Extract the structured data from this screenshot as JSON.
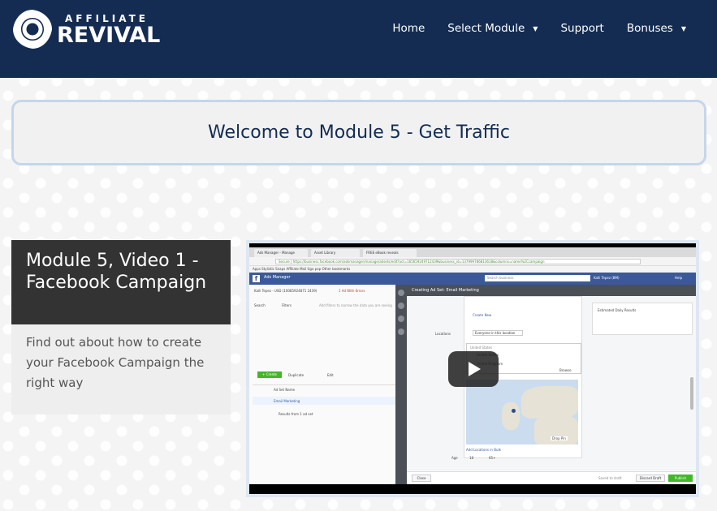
{
  "brand": {
    "line1": "AFFILIATE",
    "line2": "REVIVAL"
  },
  "nav": {
    "items": [
      {
        "label": "Home",
        "dropdown": false
      },
      {
        "label": "Select Module",
        "dropdown": true
      },
      {
        "label": "Support",
        "dropdown": false
      },
      {
        "label": "Bonuses",
        "dropdown": true
      }
    ]
  },
  "welcome": {
    "title": "Welcome to Module 5 - Get Traffic"
  },
  "card": {
    "title": "Module 5, Video 1 - Facebook Campaign",
    "description": "Find out about how to create your Facebook Campaign the right way"
  },
  "video": {
    "tabs": [
      "Ads Manager - Manage",
      "Asset Library",
      "FREE eBook reveals"
    ],
    "url": "Secure | https://business.facebook.com/adsmanager/manage/adsets/edit?act=165659249712439&business_id=137999786813618&columns=name%2Ccampaign",
    "bookmarks": "Apps  Stylistic Snaps  Affiliate  Mail  Ugo  pop  Other bookmarks",
    "app_title": "Ads Manager",
    "search_placeholder": "Search business",
    "account": "Kalli Tepez (BM)",
    "help": "Help",
    "account_select": "Kalli Tepez - USD (10085924871 2439)",
    "errors": "1 Ad With Errors",
    "search_label": "Search",
    "filters_label": "Filters",
    "filter_hint": "Add filters to narrow the data you are seeing",
    "create_label": "+ Create",
    "duplicate_label": "Duplicate",
    "edit_label": "Edit",
    "col_header": "Ad Set Name",
    "row_name": "Email Marketing",
    "row_sub": "Results from 1 ad set",
    "panel_title": "Creating Ad Set: Email Marketing",
    "create_new": "Create New",
    "locations_label": "Locations",
    "locations_value": "Everyone in this location",
    "loc_country": "United States",
    "loc_item1": "United States",
    "loc_item2": "United Kingdom",
    "browse": "Browse",
    "drop_pin": "Drop Pin",
    "add_bulk": "Add Locations in Bulk",
    "age_label": "Age",
    "age_from": "18",
    "age_to": "65+",
    "estimate_title": "Estimated Daily Results",
    "close_btn": "Close",
    "saved_text": "Saved to draft",
    "discard_btn": "Discard Draft",
    "publish_btn": "Publish"
  }
}
